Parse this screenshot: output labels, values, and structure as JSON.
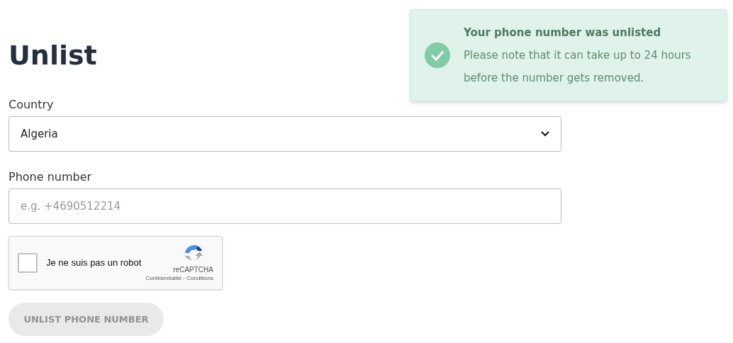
{
  "heading": "Unlist",
  "country": {
    "label": "Country",
    "value": "Algeria"
  },
  "phone": {
    "label": "Phone number",
    "placeholder": "e.g. +4690512214"
  },
  "captcha": {
    "label": "Je ne suis pas un robot",
    "checked": false,
    "brand": "reCAPTCHA",
    "links": "Confidentialité - Conditions"
  },
  "submit": {
    "label": "UNLIST PHONE NUMBER",
    "disabled": true
  },
  "toast": {
    "title": "Your phone number was unlisted",
    "message": "Please note that it can take up to 24 hours before the number gets removed."
  }
}
